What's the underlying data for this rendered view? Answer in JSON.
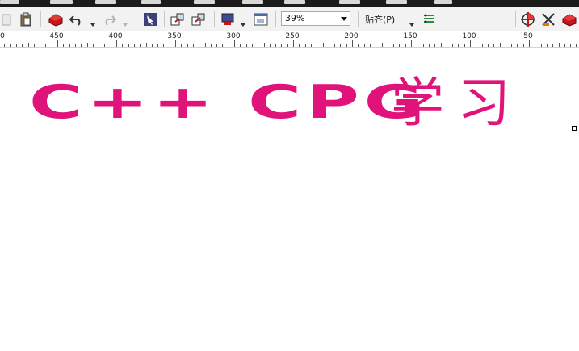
{
  "toolbar": {
    "zoom_value": "39%",
    "paste_label": "贴齐(P)",
    "icons": [
      "new-page-icon",
      "paste-icon",
      "cut-red-icon",
      "undo-icon",
      "redo-icon",
      "pick-tool-icon",
      "import-icon",
      "export-icon",
      "publish-icon",
      "app-launcher-icon",
      "align-icon",
      "options-icon",
      "transform-icon",
      "red-box-icon"
    ]
  },
  "ruler": {
    "labels": [
      "0",
      "450",
      "400",
      "350",
      "300",
      "250",
      "200",
      "150",
      "100",
      "50"
    ]
  },
  "canvas": {
    "headline": "C++ CPG",
    "chinese": "学习",
    "text_color": "#e0137a"
  }
}
